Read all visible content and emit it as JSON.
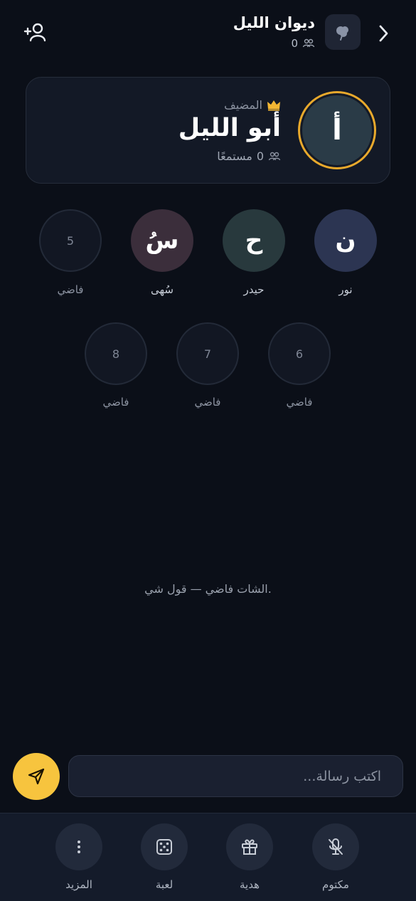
{
  "header": {
    "title": "ديوان الليل",
    "listener_count": "0",
    "back_icon": "chevron-right-icon",
    "room_icon": "cloud-bubble-icon",
    "add_user_icon": "add-user-icon"
  },
  "host": {
    "initial": "أ",
    "role_label": "المضيف",
    "crown_icon": "crown-icon",
    "name": "أبو الليل",
    "listeners_count": "0",
    "listeners_label": "مستمعًا",
    "ring_color": "#e8a92c"
  },
  "seats": [
    {
      "initial": "ن",
      "label": "نور",
      "color": "#2c3552"
    },
    {
      "initial": "ح",
      "label": "حيدر",
      "color": "#28393d"
    },
    {
      "initial": "سُ",
      "label": "سُهى",
      "color": "#3b2e3b"
    },
    {
      "number": "5",
      "label": "فاضي"
    },
    {
      "number": "6",
      "label": "فاضي"
    },
    {
      "number": "7",
      "label": "فاضي"
    },
    {
      "number": "8",
      "label": "فاضي"
    }
  ],
  "chat": {
    "empty_text": "الشات فاضي — قول شي."
  },
  "composer": {
    "placeholder": "اكتب رسالة...",
    "send_icon": "send-icon",
    "send_color": "#f7c43e"
  },
  "toolbar": [
    {
      "label": "مكتوم",
      "icon": "mic-off-icon"
    },
    {
      "label": "هدية",
      "icon": "gift-icon"
    },
    {
      "label": "لعبة",
      "icon": "dice-icon"
    },
    {
      "label": "المزيد",
      "icon": "more-vertical-icon"
    }
  ]
}
